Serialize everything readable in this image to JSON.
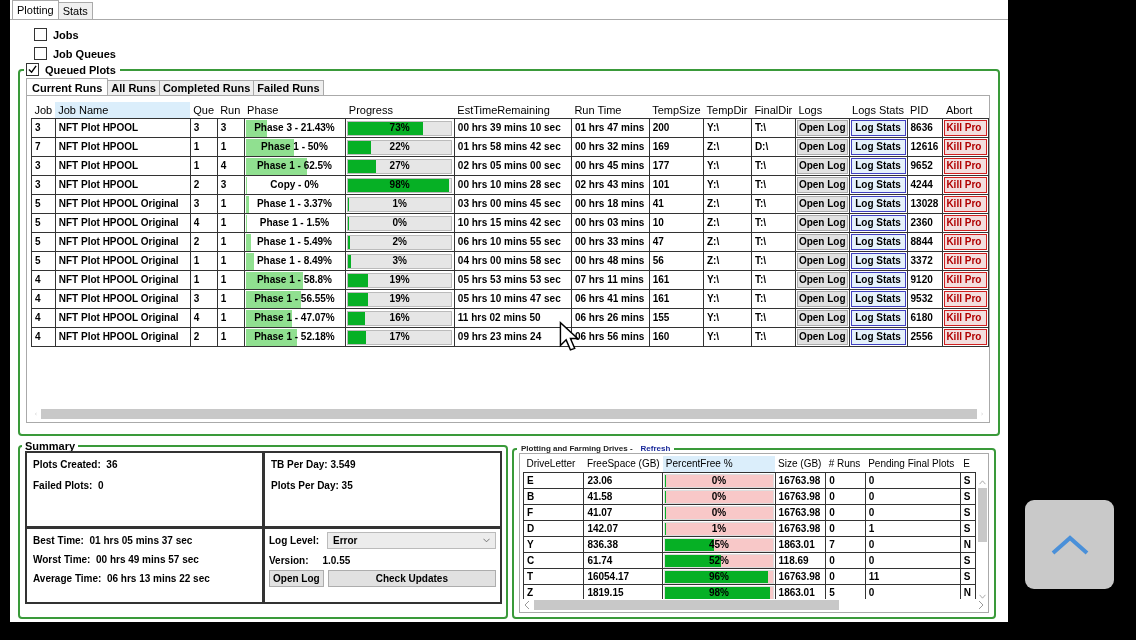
{
  "tabs": [
    {
      "label": "Plotting",
      "selected": true
    },
    {
      "label": "Stats",
      "selected": false
    }
  ],
  "sections": [
    {
      "label": "Jobs",
      "checked": false
    },
    {
      "label": "Job Queues",
      "checked": false
    },
    {
      "label": "Queued Plots",
      "checked": true
    }
  ],
  "run_tabs": [
    {
      "label": "Current Runs",
      "selected": true
    },
    {
      "label": "All Runs",
      "selected": false
    },
    {
      "label": "Completed Runs",
      "selected": false
    },
    {
      "label": "Failed Runs",
      "selected": false
    }
  ],
  "runs_table": {
    "columns": [
      "Job",
      "Job Name",
      "Que",
      "Run",
      "Phase",
      "Progress",
      "EstTimeRemaining",
      "Run Time",
      "TempSize",
      "TempDir",
      "FinalDir",
      "Logs",
      "Logs Stats",
      "PID",
      "Abort"
    ],
    "rows": [
      {
        "job": "3",
        "job_name": "NFT Plot HPOOL",
        "que": "3",
        "run": "3",
        "phase": {
          "text": "Phase 3 - 21.43%",
          "level": 0.2143
        },
        "progress": {
          "text": "73%",
          "level": 0.73
        },
        "est": "00 hrs 39 mins 10 sec",
        "run_time": "01 hrs 47 mins",
        "temp_size": "200",
        "temp_dir": "Y:\\",
        "final_dir": "T:\\",
        "logs": "Open Log",
        "log_stats": "Log Stats",
        "pid": "8636",
        "abort": "Kill Pro"
      },
      {
        "job": "7",
        "job_name": "NFT Plot HPOOL",
        "que": "1",
        "run": "1",
        "phase": {
          "text": "Phase 1 - 50%",
          "level": 0.5
        },
        "progress": {
          "text": "22%",
          "level": 0.22
        },
        "est": "01 hrs 58 mins 42 sec",
        "run_time": "00 hrs 32 mins",
        "temp_size": "169",
        "temp_dir": "Z:\\",
        "final_dir": "D:\\",
        "logs": "Open Log",
        "log_stats": "Log Stats",
        "pid": "12616",
        "abort": "Kill Pro"
      },
      {
        "job": "3",
        "job_name": "NFT Plot HPOOL",
        "que": "1",
        "run": "4",
        "phase": {
          "text": "Phase 1 - 62.5%",
          "level": 0.625
        },
        "progress": {
          "text": "27%",
          "level": 0.27
        },
        "est": "02 hrs 05 mins 00 sec",
        "run_time": "00 hrs 45 mins",
        "temp_size": "177",
        "temp_dir": "Y:\\",
        "final_dir": "T:\\",
        "logs": "Open Log",
        "log_stats": "Log Stats",
        "pid": "9652",
        "abort": "Kill Pro"
      },
      {
        "job": "3",
        "job_name": "NFT Plot HPOOL",
        "que": "2",
        "run": "3",
        "phase": {
          "text": "Copy - 0%",
          "level": 0
        },
        "progress": {
          "text": "98%",
          "level": 0.98
        },
        "est": "00 hrs 10 mins 28 sec",
        "run_time": "02 hrs 43 mins",
        "temp_size": "101",
        "temp_dir": "Y:\\",
        "final_dir": "T:\\",
        "logs": "Open Log",
        "log_stats": "Log Stats",
        "pid": "4244",
        "abort": "Kill Pro"
      },
      {
        "job": "5",
        "job_name": "NFT Plot HPOOL Original",
        "que": "3",
        "run": "1",
        "phase": {
          "text": "Phase 1 - 3.37%",
          "level": 0.0337
        },
        "progress": {
          "text": "1%",
          "level": 0.01
        },
        "est": "03 hrs 00 mins 45 sec",
        "run_time": "00 hrs 18 mins",
        "temp_size": "41",
        "temp_dir": "Z:\\",
        "final_dir": "T:\\",
        "logs": "Open Log",
        "log_stats": "Log Stats",
        "pid": "13028",
        "abort": "Kill Pro"
      },
      {
        "job": "5",
        "job_name": "NFT Plot HPOOL Original",
        "que": "4",
        "run": "1",
        "phase": {
          "text": "Phase 1 - 1.5%",
          "level": 0.015
        },
        "progress": {
          "text": "0%",
          "level": 0
        },
        "est": "10 hrs 15 mins 42 sec",
        "run_time": "00 hrs 03 mins",
        "temp_size": "10",
        "temp_dir": "Z:\\",
        "final_dir": "T:\\",
        "logs": "Open Log",
        "log_stats": "Log Stats",
        "pid": "2360",
        "abort": "Kill Pro"
      },
      {
        "job": "5",
        "job_name": "NFT Plot HPOOL Original",
        "que": "2",
        "run": "1",
        "phase": {
          "text": "Phase 1 - 5.49%",
          "level": 0.0549
        },
        "progress": {
          "text": "2%",
          "level": 0.02
        },
        "est": "06 hrs 10 mins 55 sec",
        "run_time": "00 hrs 33 mins",
        "temp_size": "47",
        "temp_dir": "Z:\\",
        "final_dir": "T:\\",
        "logs": "Open Log",
        "log_stats": "Log Stats",
        "pid": "8844",
        "abort": "Kill Pro"
      },
      {
        "job": "5",
        "job_name": "NFT Plot HPOOL Original",
        "que": "1",
        "run": "1",
        "phase": {
          "text": "Phase 1 - 8.49%",
          "level": 0.0849
        },
        "progress": {
          "text": "3%",
          "level": 0.03
        },
        "est": "04 hrs 00 mins 58 sec",
        "run_time": "00 hrs 48 mins",
        "temp_size": "56",
        "temp_dir": "Z:\\",
        "final_dir": "T:\\",
        "logs": "Open Log",
        "log_stats": "Log Stats",
        "pid": "3372",
        "abort": "Kill Pro"
      },
      {
        "job": "4",
        "job_name": "NFT Plot HPOOL Original",
        "que": "1",
        "run": "1",
        "phase": {
          "text": "Phase 1 - 58.8%",
          "level": 0.588
        },
        "progress": {
          "text": "19%",
          "level": 0.19
        },
        "est": "05 hrs 53 mins 53 sec",
        "run_time": "07 hrs 11 mins",
        "temp_size": "161",
        "temp_dir": "Y:\\",
        "final_dir": "T:\\",
        "logs": "Open Log",
        "log_stats": "Log Stats",
        "pid": "9120",
        "abort": "Kill Pro"
      },
      {
        "job": "4",
        "job_name": "NFT Plot HPOOL Original",
        "que": "3",
        "run": "1",
        "phase": {
          "text": "Phase 1 - 56.55%",
          "level": 0.5655
        },
        "progress": {
          "text": "19%",
          "level": 0.19
        },
        "est": "05 hrs 10 mins 47 sec",
        "run_time": "06 hrs 41 mins",
        "temp_size": "161",
        "temp_dir": "Y:\\",
        "final_dir": "T:\\",
        "logs": "Open Log",
        "log_stats": "Log Stats",
        "pid": "9532",
        "abort": "Kill Pro"
      },
      {
        "job": "4",
        "job_name": "NFT Plot HPOOL Original",
        "que": "4",
        "run": "1",
        "phase": {
          "text": "Phase 1 - 47.07%",
          "level": 0.4707
        },
        "progress": {
          "text": "16%",
          "level": 0.16
        },
        "est": "11 hrs 02 mins 50",
        "run_time": "06 hrs 26 mins",
        "temp_size": "155",
        "temp_dir": "Y:\\",
        "final_dir": "T:\\",
        "logs": "Open Log",
        "log_stats": "Log Stats",
        "pid": "6180",
        "abort": "Kill Pro"
      },
      {
        "job": "4",
        "job_name": "NFT Plot HPOOL Original",
        "que": "2",
        "run": "1",
        "phase": {
          "text": "Phase 1 - 52.18%",
          "level": 0.5218
        },
        "progress": {
          "text": "17%",
          "level": 0.17
        },
        "est": "09 hrs 23 mins 24",
        "run_time": "06 hrs 56 mins",
        "temp_size": "160",
        "temp_dir": "Y:\\",
        "final_dir": "T:\\",
        "logs": "Open Log",
        "log_stats": "Log Stats",
        "pid": "2556",
        "abort": "Kill Pro"
      }
    ]
  },
  "summary": {
    "title": "Summary",
    "counts": [
      {
        "label": "Plots Created:",
        "value": "36"
      },
      {
        "label": "Failed Plots:",
        "value": "0"
      }
    ],
    "rates": [
      {
        "label": "TB Per Day:",
        "value": "3.549"
      },
      {
        "label": "Plots Per Day:",
        "value": "35"
      }
    ],
    "times": [
      {
        "label": "Best Time:",
        "value": "01 hrs 05 mins 37 sec"
      },
      {
        "label": "Worst Time:",
        "value": "00 hrs 49 mins 57 sec"
      },
      {
        "label": "Average Time:",
        "value": "06 hrs 13 mins 22 sec"
      }
    ],
    "log_level": {
      "label": "Log Level:",
      "value": "Error"
    },
    "version": {
      "label": "Version:",
      "value": "1.0.55"
    },
    "buttons": [
      "Open Log",
      "Check Updates"
    ]
  },
  "drives": {
    "title": "Plotting and Farming Drives -",
    "refresh": "Refresh",
    "columns": [
      "DriveLetter",
      "FreeSpace (GB)",
      "PercentFree %",
      "Size (GB)",
      "# Runs",
      "Pending Final Plots",
      "E"
    ],
    "rows": [
      {
        "letter": "E",
        "free": "23.06",
        "percent": {
          "text": "0%",
          "level": 0
        },
        "size": "16763.98",
        "runs": "0",
        "pending": "0",
        "column_7": "S"
      },
      {
        "letter": "B",
        "free": "41.58",
        "percent": {
          "text": "0%",
          "level": 0
        },
        "size": "16763.98",
        "runs": "0",
        "pending": "0",
        "column_7": "S"
      },
      {
        "letter": "F",
        "free": "41.07",
        "percent": {
          "text": "0%",
          "level": 0
        },
        "size": "16763.98",
        "runs": "0",
        "pending": "0",
        "column_7": "S"
      },
      {
        "letter": "D",
        "free": "142.07",
        "percent": {
          "text": "1%",
          "level": 0.01
        },
        "size": "16763.98",
        "runs": "0",
        "pending": "1",
        "column_7": "S"
      },
      {
        "letter": "Y",
        "free": "836.38",
        "percent": {
          "text": "45%",
          "level": 0.45
        },
        "size": "1863.01",
        "runs": "7",
        "pending": "0",
        "column_7": "N"
      },
      {
        "letter": "C",
        "free": "61.74",
        "percent": {
          "text": "52%",
          "level": 0.52
        },
        "size": "118.69",
        "runs": "0",
        "pending": "0",
        "column_7": "S"
      },
      {
        "letter": "T",
        "free": "16054.17",
        "percent": {
          "text": "96%",
          "level": 0.96
        },
        "size": "16763.98",
        "runs": "0",
        "pending": "11",
        "column_7": "S"
      },
      {
        "letter": "Z",
        "free": "1819.15",
        "percent": {
          "text": "98%",
          "level": 0.98
        },
        "size": "1863.01",
        "runs": "5",
        "pending": "0",
        "column_7": "N"
      }
    ]
  }
}
